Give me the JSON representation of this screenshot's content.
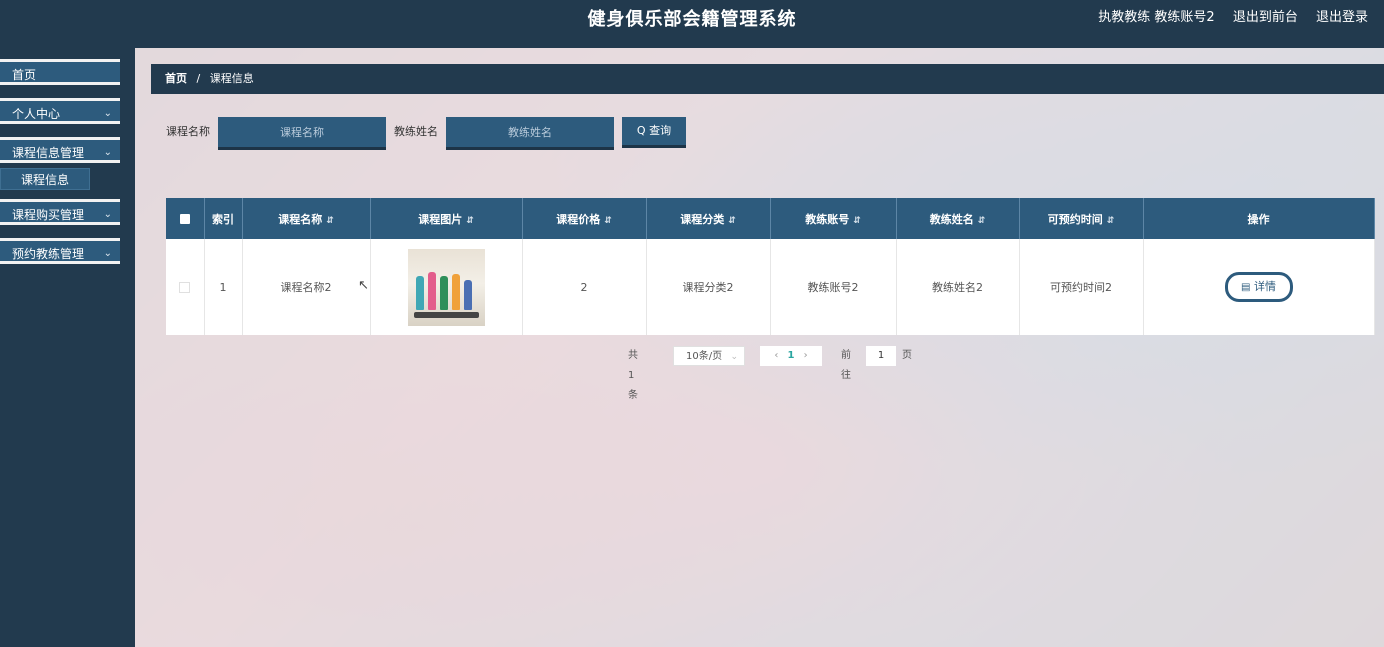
{
  "header": {
    "title": "健身俱乐部会籍管理系统",
    "user_label": "执教教练 教练账号2",
    "to_frontend": "退出到前台",
    "logout": "退出登录"
  },
  "sidebar": {
    "items": [
      {
        "label": "首页",
        "has_arrow": false
      },
      {
        "label": "个人中心",
        "has_arrow": true
      },
      {
        "label": "课程信息管理",
        "has_arrow": true
      },
      {
        "label": "课程购买管理",
        "has_arrow": true
      },
      {
        "label": "预约教练管理",
        "has_arrow": true
      }
    ],
    "sub_active": "课程信息",
    "arrow_icon": "chevron-down-icon"
  },
  "breadcrumb": {
    "home": "首页",
    "separator": "/",
    "current": "课程信息"
  },
  "search": {
    "course_label": "课程名称",
    "course_placeholder": "课程名称",
    "coach_label": "教练姓名",
    "coach_placeholder": "教练姓名",
    "button_label": "Q 查询"
  },
  "table": {
    "columns": [
      "索引",
      "课程名称",
      "课程图片",
      "课程价格",
      "课程分类",
      "教练账号",
      "教练姓名",
      "可预约时间",
      "操作"
    ],
    "sortable": [
      false,
      true,
      true,
      true,
      true,
      true,
      true,
      true,
      false
    ],
    "rows": [
      {
        "index": "1",
        "course_name": "课程名称2",
        "image": "fitness-class-photo",
        "price": "2",
        "category": "课程分类2",
        "coach_account": "教练账号2",
        "coach_name": "教练姓名2",
        "available_time": "可预约时间2",
        "action": "详情"
      }
    ]
  },
  "pagination": {
    "total": "共 1 条",
    "page_size": "10条/页",
    "current_page": "1",
    "goto_label": "前往",
    "goto_value": "1",
    "page_unit": "页"
  },
  "colors": {
    "header_bg": "#223a4e",
    "accent": "#2d5b7d",
    "active_page": "#2aa5a0"
  }
}
